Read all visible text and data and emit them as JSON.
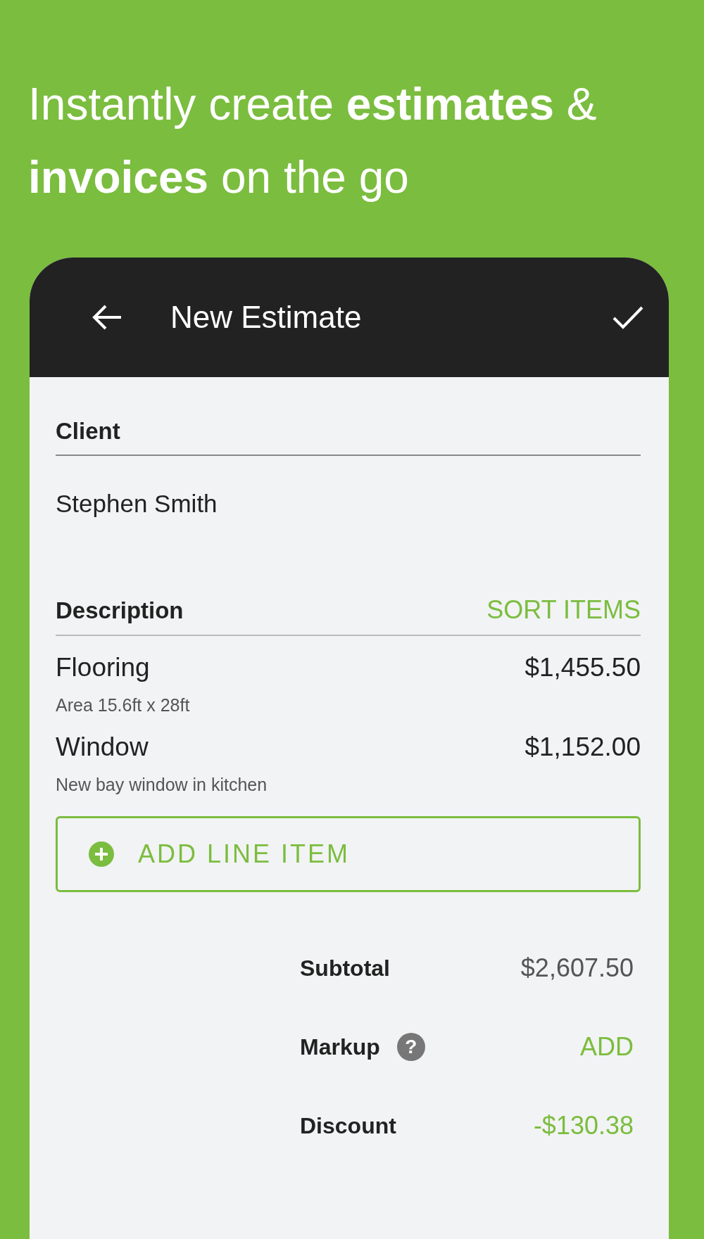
{
  "headline": "Instantly create **estimates** & **invoices** on the go",
  "app_bar": {
    "title": "New Estimate"
  },
  "client": {
    "label": "Client",
    "value": "Stephen Smith"
  },
  "description": {
    "label": "Description",
    "action": "SORT ITEMS"
  },
  "items": [
    {
      "name": "Flooring",
      "detail": "Area 15.6ft x 28ft",
      "amount": "$1,455.50"
    },
    {
      "name": "Window",
      "detail": "New bay window in kitchen",
      "amount": "$1,152.00"
    }
  ],
  "add_button": "ADD LINE ITEM",
  "totals": [
    {
      "label": "Subtotal",
      "value": "$2,607.50",
      "kind": "amount"
    },
    {
      "label": "Markup",
      "help": "?",
      "value": "ADD",
      "kind": "action"
    },
    {
      "label": "Discount",
      "value": "-$130.38",
      "kind": "discount"
    }
  ]
}
